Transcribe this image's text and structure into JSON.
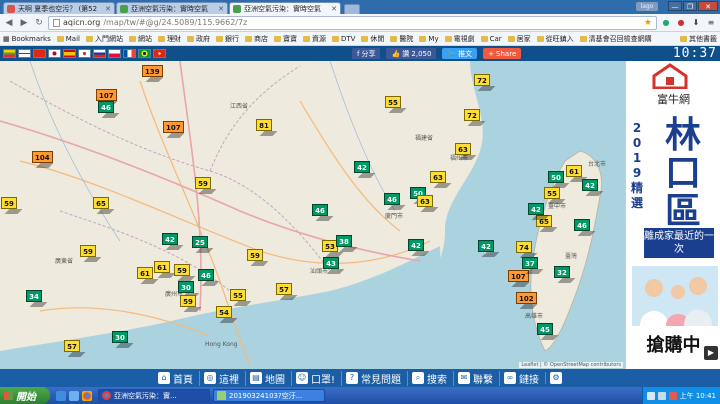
{
  "tabs": [
    {
      "label": "天啊 夏季也空污？ (第52",
      "icon": "page-icon",
      "active": false
    },
    {
      "label": "亞洲空氣污染：實時空氣",
      "icon": "aqicn-icon",
      "active": false
    },
    {
      "label": "亞洲空氣污染：實時空氣",
      "icon": "aqicn-icon",
      "active": true
    }
  ],
  "window": {
    "user_label": "lago",
    "minimize": "—",
    "restore": "❐",
    "close": "✕"
  },
  "address": {
    "url_host": "aqicn.org",
    "url_path": "/map/tw/#@g/24.5089/115.9662/7z"
  },
  "bookmarks": {
    "label": "Bookmarks",
    "items": [
      "Mail",
      "入門網站",
      "網站",
      "理財",
      "政府",
      "銀行",
      "商店",
      "寶寶",
      "資源",
      "DTV",
      "休閒",
      "醫院",
      "My",
      "電視劇",
      "Car",
      "居家",
      "從旺鎮入",
      "清基會召回檢查網購"
    ],
    "other": "其他書籤"
  },
  "toolbar": {
    "flags": [
      "mm",
      "gb",
      "cn",
      "jp",
      "es",
      "kr",
      "ru",
      "pl",
      "fr",
      "br",
      "vn"
    ],
    "fb_share": "分享",
    "fb_like": "讚 2,050",
    "tweet": "推文",
    "share": "Share",
    "clock": "10:37"
  },
  "map": {
    "attribution": "Leaflet | © OpenStreetMap contributors",
    "places": [
      {
        "name": "福建省"
      },
      {
        "name": "江西省"
      },
      {
        "name": "廣東省"
      },
      {
        "name": "臺灣"
      },
      {
        "name": "Hong Kong"
      },
      {
        "name": "廣州市"
      },
      {
        "name": "廈門市"
      },
      {
        "name": "福州市"
      },
      {
        "name": "台北市"
      },
      {
        "name": "高雄市"
      },
      {
        "name": "汕頭市"
      },
      {
        "name": "臺中市"
      }
    ],
    "markers": [
      {
        "aqi": "139",
        "level": "o"
      },
      {
        "aqi": "107",
        "level": "o"
      },
      {
        "aqi": "46",
        "level": "g"
      },
      {
        "aqi": "107",
        "level": "o"
      },
      {
        "aqi": "81",
        "level": "y"
      },
      {
        "aqi": "55",
        "level": "y"
      },
      {
        "aqi": "72",
        "level": "y"
      },
      {
        "aqi": "72",
        "level": "y"
      },
      {
        "aqi": "104",
        "level": "o"
      },
      {
        "aqi": "63",
        "level": "y"
      },
      {
        "aqi": "65",
        "level": "y"
      },
      {
        "aqi": "59",
        "level": "y"
      },
      {
        "aqi": "42",
        "level": "g"
      },
      {
        "aqi": "63",
        "level": "y"
      },
      {
        "aqi": "50",
        "level": "g"
      },
      {
        "aqi": "59",
        "level": "y"
      },
      {
        "aqi": "46",
        "level": "g"
      },
      {
        "aqi": "46",
        "level": "g"
      },
      {
        "aqi": "63",
        "level": "y"
      },
      {
        "aqi": "42",
        "level": "g"
      },
      {
        "aqi": "25",
        "level": "g"
      },
      {
        "aqi": "59",
        "level": "y"
      },
      {
        "aqi": "53",
        "level": "y"
      },
      {
        "aqi": "38",
        "level": "g"
      },
      {
        "aqi": "43",
        "level": "g"
      },
      {
        "aqi": "61",
        "level": "y"
      },
      {
        "aqi": "61",
        "level": "y"
      },
      {
        "aqi": "59",
        "level": "y"
      },
      {
        "aqi": "46",
        "level": "g"
      },
      {
        "aqi": "30",
        "level": "g"
      },
      {
        "aqi": "55",
        "level": "y"
      },
      {
        "aqi": "57",
        "level": "y"
      },
      {
        "aqi": "34",
        "level": "g"
      },
      {
        "aqi": "59",
        "level": "y"
      },
      {
        "aqi": "54",
        "level": "y"
      },
      {
        "aqi": "30",
        "level": "g"
      },
      {
        "aqi": "57",
        "level": "y"
      },
      {
        "aqi": "42",
        "level": "g"
      },
      {
        "aqi": "61",
        "level": "y"
      },
      {
        "aqi": "50",
        "level": "g"
      },
      {
        "aqi": "55",
        "level": "y"
      },
      {
        "aqi": "42",
        "level": "g"
      },
      {
        "aqi": "65",
        "level": "y"
      },
      {
        "aqi": "74",
        "level": "y"
      },
      {
        "aqi": "46",
        "level": "g"
      },
      {
        "aqi": "107",
        "level": "o"
      },
      {
        "aqi": "102",
        "level": "o"
      },
      {
        "aqi": "32",
        "level": "g"
      },
      {
        "aqi": "45",
        "level": "g"
      },
      {
        "aqi": "59",
        "level": "y"
      },
      {
        "aqi": "42",
        "level": "g"
      },
      {
        "aqi": "42",
        "level": "g"
      },
      {
        "aqi": "37",
        "level": "g"
      }
    ]
  },
  "ad": {
    "brand": "富牛網",
    "year_chars": [
      "2",
      "0",
      "1",
      "9",
      "精",
      "選"
    ],
    "title_chars": [
      "林",
      "口",
      "區"
    ],
    "tagline": "離成家最近的一次",
    "cta": "搶購中",
    "ad_chip": "▶"
  },
  "bottom_nav": [
    {
      "label": "首頁",
      "icon": "home-icon"
    },
    {
      "label": "這裡",
      "icon": "location-icon"
    },
    {
      "label": "地圖",
      "icon": "map-icon"
    },
    {
      "label": "口罩!",
      "icon": "mask-icon"
    },
    {
      "label": "常見問題",
      "icon": "faq-icon"
    },
    {
      "label": "搜索",
      "icon": "search-icon"
    },
    {
      "label": "聯繫",
      "icon": "contact-icon"
    },
    {
      "label": "鏈接",
      "icon": "link-icon"
    },
    {
      "label": "",
      "icon": "settings-icon"
    }
  ],
  "taskbar": {
    "start": "開始",
    "tasks": [
      "亞洲空氣污染：實...",
      "20190324103?空汙..."
    ],
    "clock": "上午 10:41"
  },
  "colors": {
    "good": "#009966",
    "moderate": "#ffde33",
    "sensitive": "#ff9933",
    "nav_blue": "#1b5ea6"
  }
}
